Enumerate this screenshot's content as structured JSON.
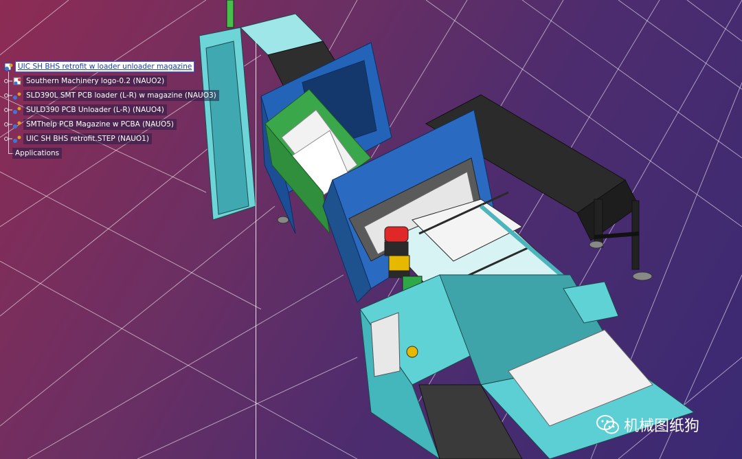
{
  "spec_tree": {
    "root": {
      "label": "UIC SH BHS retrofit w loader unloader magazine"
    },
    "children": [
      {
        "label": "Southern Machinery logo-0.2 (NAUO2)",
        "icon": "part-icon"
      },
      {
        "label": "SLD390L SMT PCB loader (L-R) w magazine (NAUO3)",
        "icon": "product-icon"
      },
      {
        "label": "SULD390 PCB Unloader (L-R) (NAUO4)",
        "icon": "product-icon"
      },
      {
        "label": "SMThelp PCB Magazine w PCBA (NAUO5)",
        "icon": "product-icon"
      },
      {
        "label": "UIC SH BHS retrofit.STEP (NAUO1)",
        "icon": "product-icon"
      }
    ],
    "applications": {
      "label": "Applications"
    }
  },
  "watermark": {
    "text": "机械图纸狗",
    "icon": "wechat-icon"
  },
  "colors": {
    "machine_cyan": "#5fd2d6",
    "machine_blue": "#1e5fb0",
    "machine_green": "#3aa84a",
    "frame_dark": "#2a2a2a"
  }
}
